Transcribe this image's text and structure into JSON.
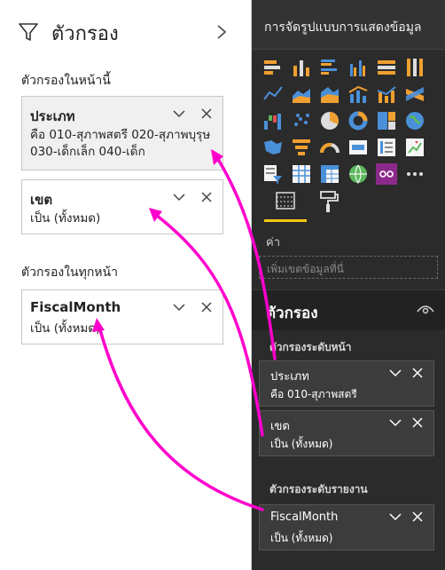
{
  "left_pane": {
    "title": "ตัวกรอง",
    "icon": "filter-funnel-icon",
    "page_section_title": "ตัวกรองในหน้านี้",
    "all_pages_section_title": "ตัวกรองในทุกหน้า",
    "page_filters": [
      {
        "title": "ประเภท",
        "line1": "คือ 010-สุภาพสตรี 020-สุภาพบุรุษ",
        "line2": "030-เด็กเล็ก 040-เด็ก",
        "selected": true
      },
      {
        "title": "เขต",
        "line1": "เป็น (ทั้งหมด)",
        "line2": "",
        "selected": false
      }
    ],
    "all_pages_filters": [
      {
        "title": "FiscalMonth",
        "line1": "เป็น (ทั้งหมด)",
        "line2": "",
        "selected": false
      }
    ]
  },
  "right_pane": {
    "title": "การจัดรูปแบบการแสดงข้อมูล",
    "values_label": "ค่า",
    "add_field_placeholder": "เพิ่มเขตข้อมูลที่นี่",
    "filters_title": "ตัวกรอง",
    "page_level_label": "ตัวกรองระดับหน้า",
    "report_level_label": "ตัวกรองระดับรายงาน",
    "page_level_filters": [
      {
        "title": "ประเภท",
        "desc": "คือ 010-สุภาพสตรี"
      },
      {
        "title": "เขต",
        "desc": "เป็น (ทั้งหมด)"
      }
    ],
    "report_level_filters": [
      {
        "title": "FiscalMonth",
        "desc": "เป็น (ทั้งหมด)"
      }
    ],
    "tabs": [
      "fields-tab",
      "format-tab"
    ],
    "active_tab": "fields-tab"
  },
  "colors": {
    "arrow": "#ff00cc",
    "accent_yellow": "#f2c811",
    "dark_pane": "#2b2b2b",
    "card_selected": "#f0f0f0"
  }
}
